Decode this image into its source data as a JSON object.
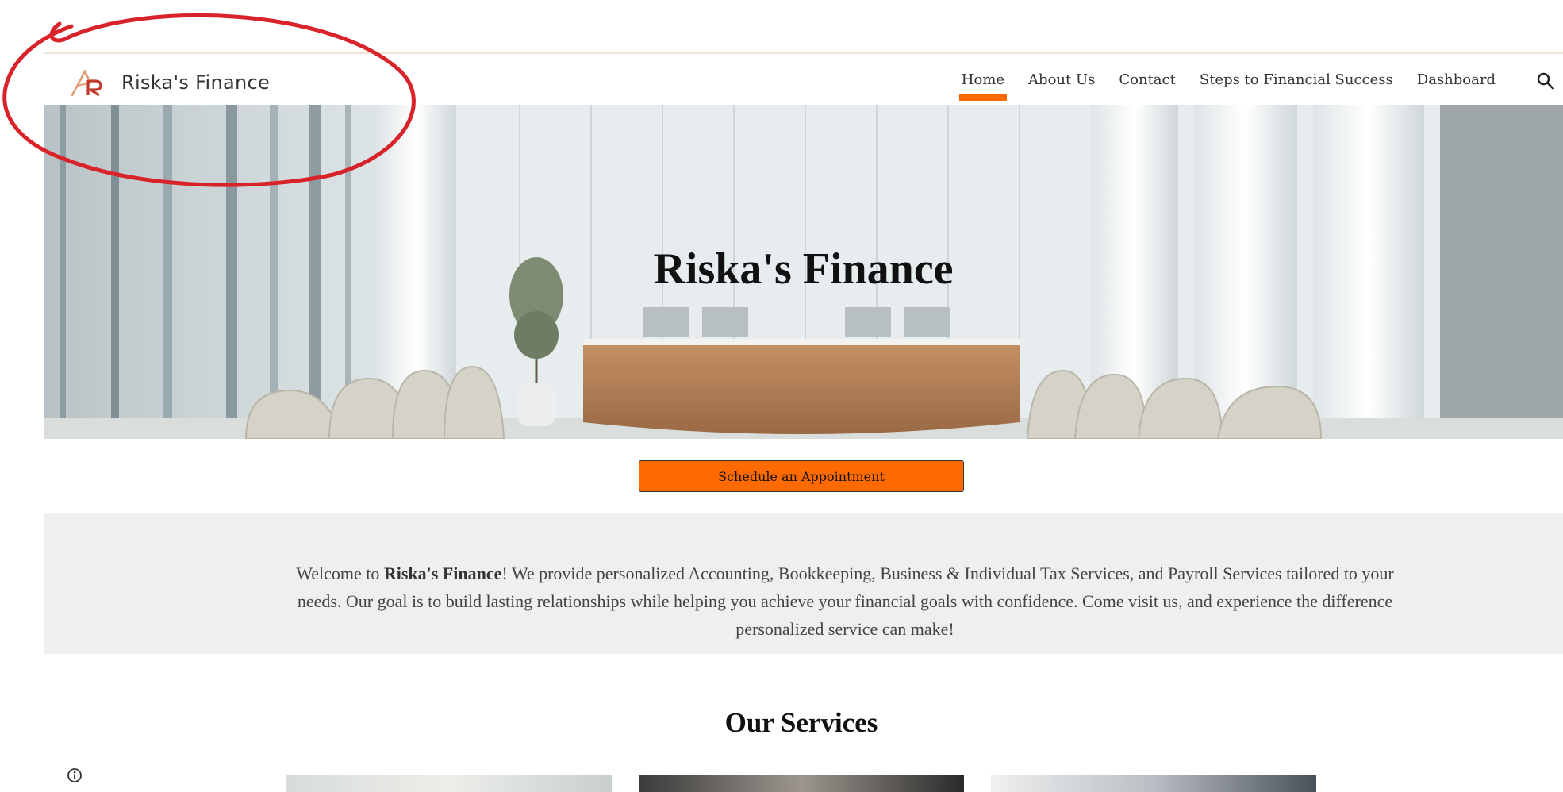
{
  "header": {
    "brand_name": "Riska's Finance",
    "nav": [
      {
        "label": "Home",
        "active": true
      },
      {
        "label": "About Us",
        "active": false
      },
      {
        "label": "Contact",
        "active": false
      },
      {
        "label": "Steps to Financial Success",
        "active": false
      },
      {
        "label": "Dashboard",
        "active": false
      }
    ],
    "search_icon": "search-icon"
  },
  "hero": {
    "title": "Riska's Finance"
  },
  "cta": {
    "label": "Schedule an Appointment"
  },
  "welcome": {
    "prefix": "Welcome to ",
    "brand": "Riska's Finance",
    "body": "! We provide personalized Accounting, Bookkeeping, Business & Individual Tax Services, and Payroll Services tailored to your needs. Our goal is to build lasting relationships while helping you achieve your financial goals with confidence. Come visit us, and experience the difference personalized service can make!"
  },
  "services": {
    "title": "Our Services"
  },
  "colors": {
    "accent": "#ff6a00",
    "annotation": "#d8232a",
    "band": "#efefef"
  },
  "icons": {
    "logo": "riska-logo",
    "search": "search-icon",
    "info": "info-icon"
  }
}
